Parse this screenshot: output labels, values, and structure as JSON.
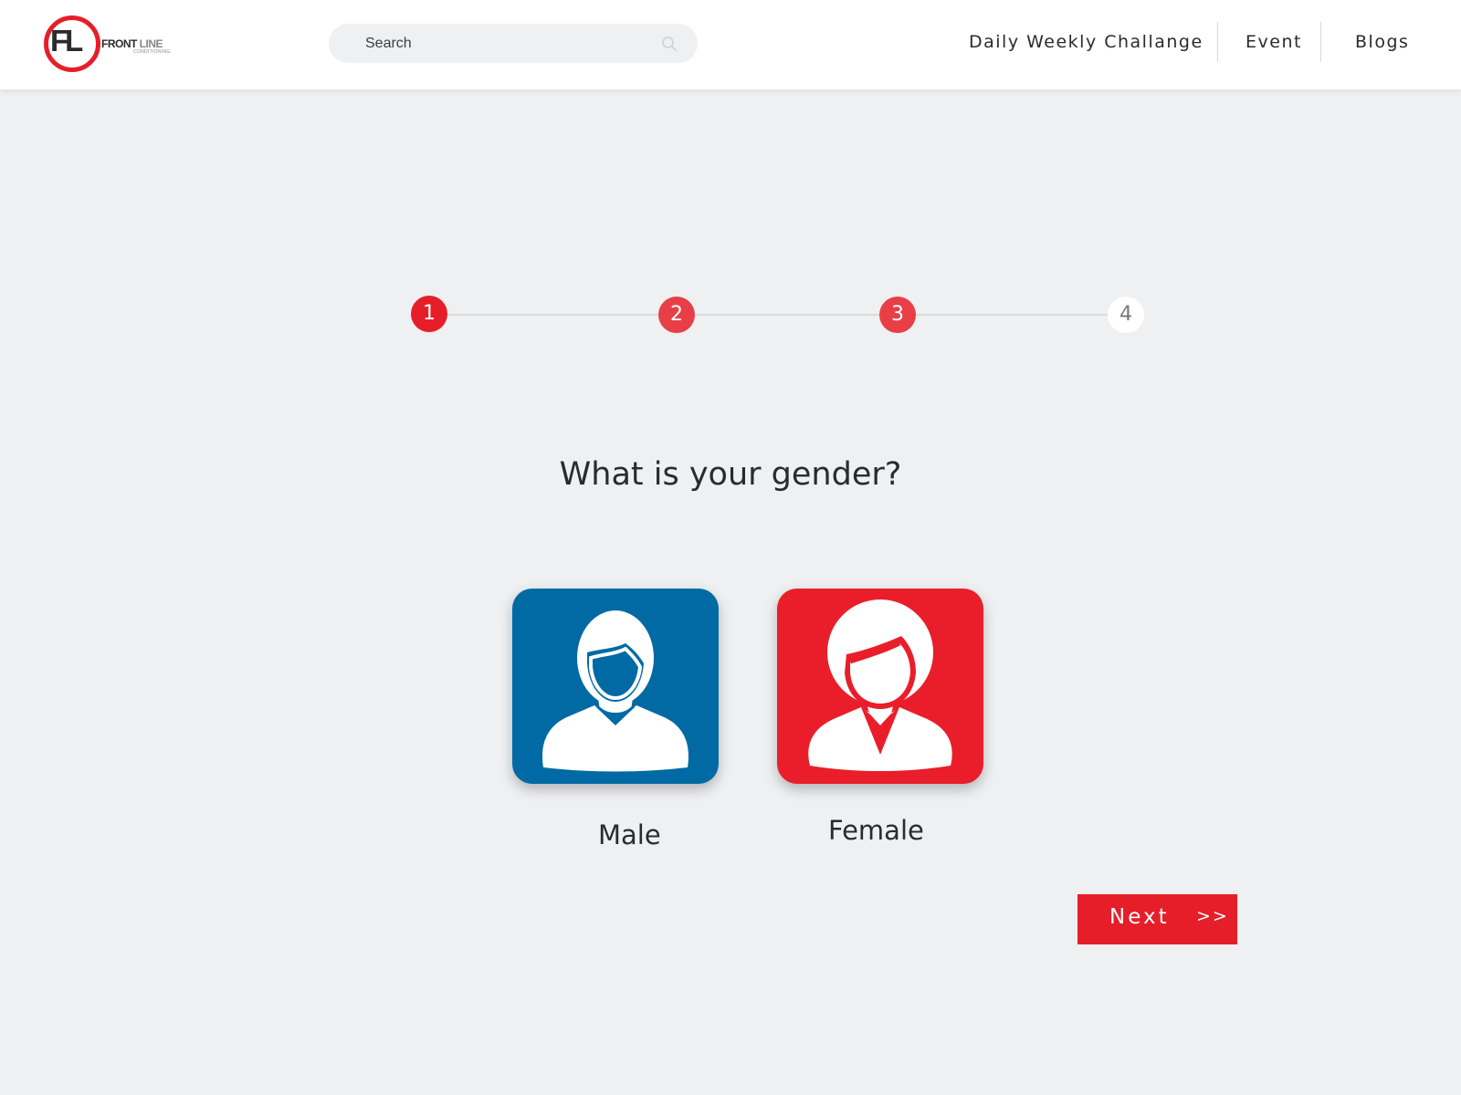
{
  "header": {
    "logo": {
      "mark": "FL",
      "name_primary": "FRONT",
      "name_secondary": "LINE",
      "subtitle": "CONDITIONING"
    },
    "search": {
      "placeholder": "Search",
      "value": "",
      "icon": "search-icon"
    },
    "nav": [
      {
        "label": "Daily Weekly Challange"
      },
      {
        "label": "Event"
      },
      {
        "label": "Blogs"
      }
    ]
  },
  "stepper": {
    "current": 1,
    "steps": [
      {
        "label": "1",
        "state": "active"
      },
      {
        "label": "2",
        "state": "completed"
      },
      {
        "label": "3",
        "state": "completed"
      },
      {
        "label": "4",
        "state": "upcoming"
      }
    ]
  },
  "question": {
    "title": "What is your gender?"
  },
  "options": [
    {
      "label": "Male",
      "icon": "male-avatar-icon",
      "color": "#016aa4"
    },
    {
      "label": "Female",
      "icon": "female-avatar-icon",
      "color": "#ea1e2a"
    }
  ],
  "actions": {
    "next_label": "Next",
    "next_arrows": ">>"
  },
  "colors": {
    "accent": "#e61e29",
    "male_tile": "#016aa4",
    "female_tile": "#ea1e2a",
    "page_background": "#eff0f2"
  }
}
